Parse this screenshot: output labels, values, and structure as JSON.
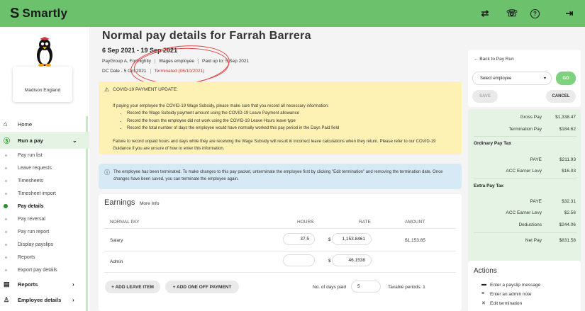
{
  "app": {
    "name": "Smartly",
    "logo_glyph": "S"
  },
  "topbar": {
    "icons": [
      {
        "name": "swap-arrows-icon",
        "glyph": "⇄"
      },
      {
        "name": "phone-icon",
        "glyph": "☏"
      },
      {
        "name": "help-icon",
        "glyph": "?"
      },
      {
        "name": "logout-icon",
        "glyph": "⇥"
      }
    ]
  },
  "user": {
    "name": "Madison England"
  },
  "nav": {
    "home": "Home",
    "run_a_pay": "Run a pay",
    "sub": [
      "Pay run list",
      "Leave requests",
      "Timesheets",
      "Timesheet import",
      "Pay details",
      "Pay reversal",
      "Pay run report",
      "Display payslips",
      "Reports",
      "Export pay details"
    ],
    "reports": "Reports",
    "employee_details": "Employee details"
  },
  "header": {
    "title": "Normal pay details for Farrah Barrera",
    "date_range": "6 Sep 2021 - 19 Sep 2021",
    "paygroup": "PayGroup A, Fortnightly",
    "employee_type": "Wages employee",
    "paid_up_to": "Paid up to: 5 Sep 2021",
    "dc_date": "DC Date - 5 Oct 2021",
    "terminated": "Terminated (06/10/2021)"
  },
  "covid_notice": {
    "title": "COVID-19 PAYMENT UPDATE:",
    "intro": "If paying your employee the COVID-19 Wage Subsidy, please make sure that you record all necessary information:",
    "items": [
      "Record the Wage Subsidy payment amount using the COVID-19 Leave Payment allowance",
      "Record the hours the employee did not work using the COVID-19 Leave Hours leave type",
      "Record the total number of days the employee would have normally worked this pay period in the Days Paid field"
    ],
    "footer": "Failure to record unpaid hours and days while they are receiving the Wage Subsidy will result in incorrect leave calculations when they return. Please refer to our COVID-19 Guidance if you are unsure of how to enter this information."
  },
  "info_notice": {
    "text": "The employee has been terminated. To make changes to this pay packet, unterminate the employee first by clicking \"Edit termination\" and removing the termination date. Once changes have been saved, you can terminate the employee again."
  },
  "earnings": {
    "title": "Earnings",
    "more_info": "More Info",
    "columns": {
      "normal_pay": "NORMAL PAY",
      "hours": "HOURS",
      "rate": "RATE",
      "amount": "AMOUNT"
    },
    "currency_symbol": "$",
    "rows": [
      {
        "label": "Salary",
        "hours": "37.5",
        "rate": "1,153.8461",
        "amount": "$1,153.85"
      },
      {
        "label": "Admin",
        "hours": "",
        "rate": "46.1538",
        "amount": ""
      }
    ],
    "add_leave_item": "+ ADD LEAVE ITEM",
    "add_one_off": "+ ADD ONE OFF PAYMENT",
    "days_paid_label": "No. of days paid",
    "days_paid_value": "5",
    "taxable_periods": "Taxable periods: 1"
  },
  "right_panel": {
    "back_link": "← Back to Pay Run",
    "select_placeholder": "Select employee",
    "go": "GO",
    "save": "SAVE",
    "cancel": "CANCEL",
    "gross_pay_label": "Gross Pay",
    "gross_pay": "$1,338.47",
    "termination_pay_label": "Termination Pay",
    "termination_pay": "$184.62",
    "ordinary_pay_tax": "Ordinary Pay Tax",
    "paye_label": "PAYE",
    "ordinary_paye": "$211.93",
    "acc_label": "ACC Earner Levy",
    "ordinary_acc": "$16.03",
    "extra_pay_tax": "Extra Pay Tax",
    "extra_paye": "$32.31",
    "extra_acc": "$2.56",
    "deductions_label": "Deductions",
    "deductions": "$244.06",
    "net_pay_label": "Net Pay",
    "net_pay": "$831.58"
  },
  "actions": {
    "title": "Actions",
    "items": [
      "Enter a payslip message",
      "Enter an admin note",
      "Edit termination"
    ]
  },
  "colors": {
    "brand_green": "#6cc16c",
    "warning_yellow": "#fdf2b4",
    "info_blue": "#d6eaf6",
    "alert_red": "#c0392b"
  }
}
